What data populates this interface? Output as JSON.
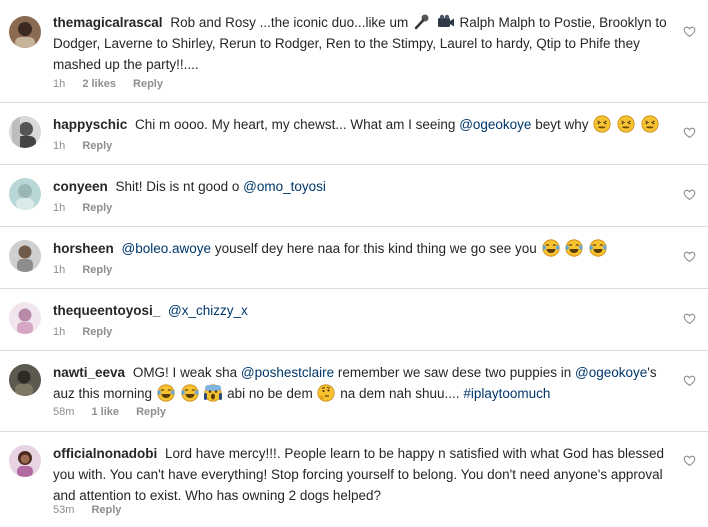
{
  "icons": {
    "like": "heart-outline-icon"
  },
  "comments": [
    {
      "username": "themagicalrascal",
      "text_a": "Rob and Rosy ...the iconic duo...like um",
      "emoji_a": [
        "microphone-emoji",
        "video-camera-emoji"
      ],
      "text_b": "Ralph Malph to Postie, Brooklyn to Dodger, Laverne to Shirley, Rerun to Rodger, Ren to the Stimpy, Laurel to hardy, Qtip to Phife they mashed up the party!!....",
      "time": "1h",
      "likes": "2 likes",
      "reply": "Reply"
    },
    {
      "username": "happyschic",
      "text_a": "Chi m oooo. My heart, my chewst... What am I seeing",
      "mention": "@ogeokoye",
      "text_b": " beyt why",
      "emoji": [
        "confounded-face-emoji",
        "confounded-face-emoji",
        "confounded-face-emoji"
      ],
      "time": "1h",
      "reply": "Reply"
    },
    {
      "username": "conyeen",
      "text_a": "Shit! Dis is nt good o",
      "mention": "@omo_toyosi",
      "time": "1h",
      "reply": "Reply"
    },
    {
      "username": "horsheen",
      "mention": "@boleo.awoye",
      "text_a": " youself dey here naa for this kind thing we go see you",
      "emoji": [
        "tears-of-joy-emoji",
        "tears-of-joy-emoji",
        "tears-of-joy-emoji"
      ],
      "time": "1h",
      "reply": "Reply"
    },
    {
      "username": "thequeentoyosi_",
      "mention": "@x_chizzy_x",
      "time": "1h",
      "reply": "Reply"
    },
    {
      "username": "nawti_eeva",
      "text_a": "OMG! I weak sha",
      "mention_a": "@poshestclaire",
      "text_b": " remember we saw dese two puppies  in",
      "mention_b": "@ogeokoye",
      "text_c": "'s auz this morning",
      "emoji_a": [
        "tears-of-joy-emoji",
        "tears-of-joy-emoji",
        "screaming-face-emoji"
      ],
      "text_d": " abi no be dem",
      "emoji_b": [
        "thinking-face-emoji"
      ],
      "text_e": " na dem nah shuu....",
      "hashtag": "#iplaytoomuch",
      "time": "58m",
      "likes": "1 like",
      "reply": "Reply"
    },
    {
      "username": "officialnonadobi",
      "text_a": "Lord have mercy!!!. People learn to be happy n satisfied with what God has blessed you with. You can't have everything! Stop forcing yourself to belong. You don't need anyone's approval and attention to exist. Who has owning 2 dogs helped?",
      "time": "53m",
      "reply": "Reply"
    }
  ]
}
